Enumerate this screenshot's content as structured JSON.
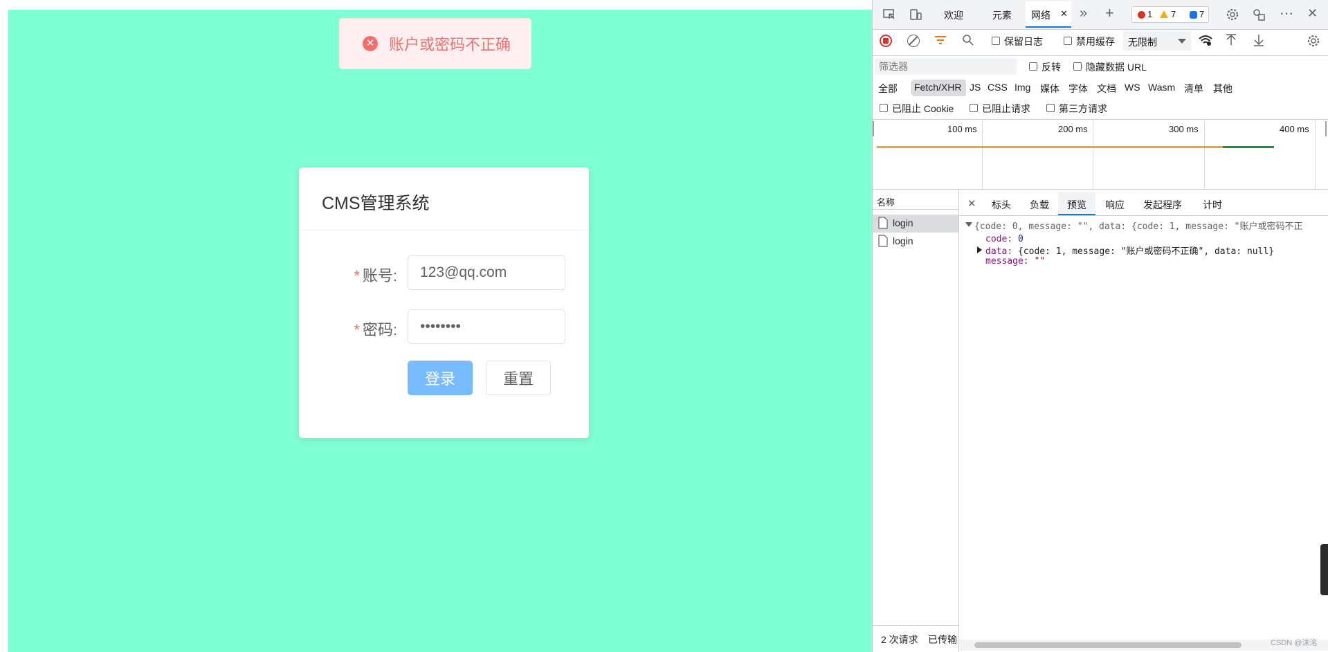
{
  "page": {
    "background_color": "#7fffd4",
    "message": {
      "icon": "error-circle-icon",
      "text": "账户或密码不正确",
      "color": "#f56c6c"
    },
    "login_card": {
      "title": "CMS管理系统",
      "required_mark": "*",
      "account_label": "账号:",
      "account_value": "123@qq.com",
      "password_label": "密码:",
      "password_value": "••••••••",
      "login_button": "登录",
      "reset_button": "重置",
      "login_button_color": "#79bbff"
    }
  },
  "devtools": {
    "tabs": {
      "welcome": "欢迎",
      "elements": "元素",
      "network": "网络",
      "close_glyph": "✕",
      "more_glyph": "»",
      "add_glyph": "+",
      "errors": "1",
      "warnings": "7",
      "messages": "7",
      "overflow_glyph": "⋯",
      "close_devtools_glyph": "✕"
    },
    "toolbar": {
      "preserve_log": "保留日志",
      "disable_cache": "禁用缓存",
      "throttling": "无限制"
    },
    "filter_bar": {
      "placeholder": "筛选器",
      "invert": "反转",
      "hide_data_urls": "隐藏数据 URL"
    },
    "type_filters": [
      "全部",
      "Fetch/XHR",
      "JS",
      "CSS",
      "Img",
      "媒体",
      "字体",
      "文档",
      "WS",
      "Wasm",
      "清单",
      "其他"
    ],
    "active_type_filter": "Fetch/XHR",
    "blocked_filters": {
      "blocked_cookies": "已阻止 Cookie",
      "blocked_requests": "已阻止请求",
      "third_party": "第三方请求"
    },
    "timeline": {
      "ticks": [
        "100 ms",
        "200 ms",
        "300 ms",
        "400 ms"
      ]
    },
    "request_list": {
      "header": "名称",
      "items": [
        "login",
        "login"
      ]
    },
    "detail_tabs": {
      "close_glyph": "✕",
      "headers": "标头",
      "payload": "负载",
      "preview": "预览",
      "response": "响应",
      "initiator": "发起程序",
      "timing": "计时"
    },
    "preview": {
      "summary": "{code: 0, message: \"\", data: {code: 1, message: \"账户或密码不正",
      "code_key": "code",
      "code_value": "0",
      "data_key": "data",
      "data_value": "{code: 1, message: \"账户或密码不正确\", data: null}",
      "message_key": "message",
      "message_value": "\"\""
    },
    "status_bar": {
      "requests": "2 次请求",
      "transferred": "已传输"
    }
  },
  "watermark": "CSDN @沫洺"
}
